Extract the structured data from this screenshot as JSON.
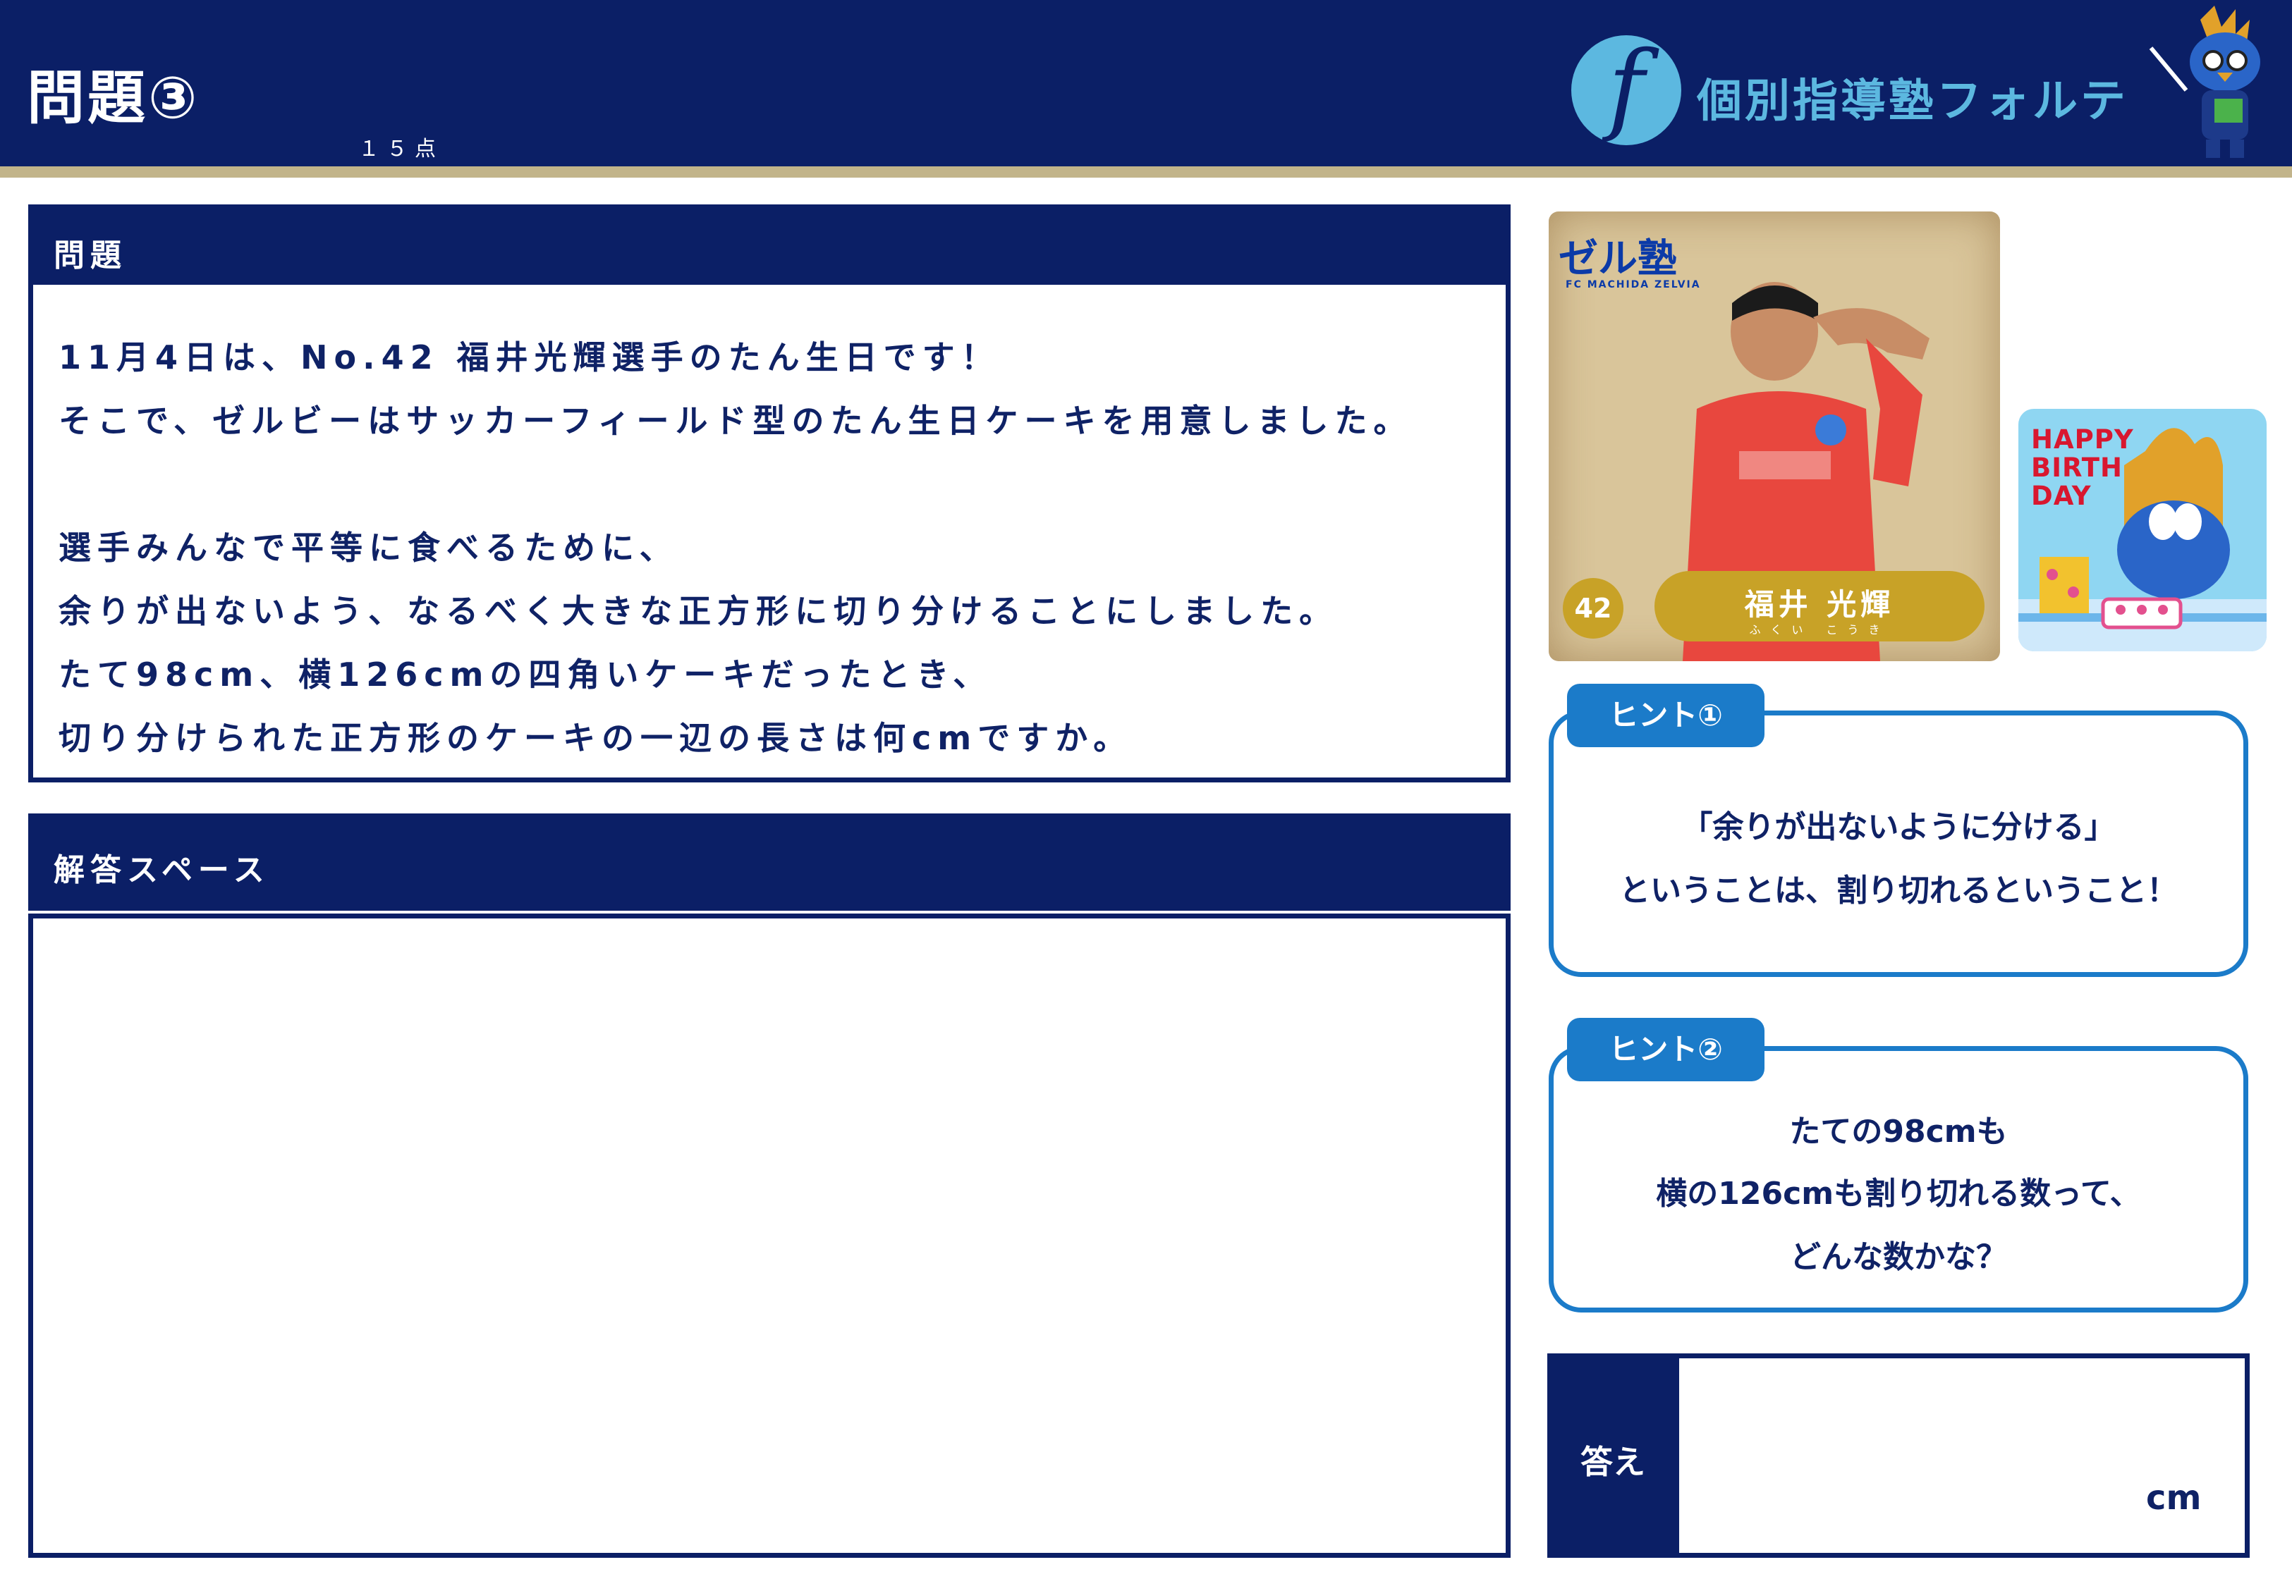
{
  "header": {
    "title": "問題③",
    "points": "１５点",
    "school_name": "個別指導塾フォルテ",
    "logo_letter": "f"
  },
  "question": {
    "heading": "問題",
    "lines": [
      "11月4日は、No.42 福井光輝選手のたん生日です！",
      "そこで、ゼルビーはサッカーフィールド型のたん生日ケーキを用意しました。",
      "",
      "選手みんなで平等に食べるために、",
      "余りが出ないよう、なるべく大きな正方形に切り分けることにしました。",
      "たて98cm、横126cmの四角いケーキだったとき、",
      "切り分けられた正方形のケーキの一辺の長さは何cmですか。"
    ]
  },
  "answer_space": {
    "heading": "解答スペース"
  },
  "player_card": {
    "logo_text": "ゼル塾",
    "logo_sub": "FC MACHIDA ZELVIA",
    "number": "42",
    "name": "福井 光輝",
    "name_kana": "ふくい こうき",
    "jersey_color": "#e8473e"
  },
  "birthday_card": {
    "line1": "HAPPY",
    "line2": "BIRTH",
    "line3": "DAY"
  },
  "hint1": {
    "label": "ヒント①",
    "line1": "「余りが出ないように分ける」",
    "line2": "ということは、割り切れるということ！"
  },
  "hint2": {
    "label": "ヒント②",
    "line1": "たての98cmも",
    "line2": "横の126cmも割り切れる数って、",
    "line3": "どんな数かな？"
  },
  "answer": {
    "label": "答え",
    "unit": "cm"
  },
  "colors": {
    "navy": "#0b1f66",
    "gold": "#c2b48a",
    "hint_blue": "#1b7bc9",
    "logo_light_blue": "#5cb8e0"
  }
}
